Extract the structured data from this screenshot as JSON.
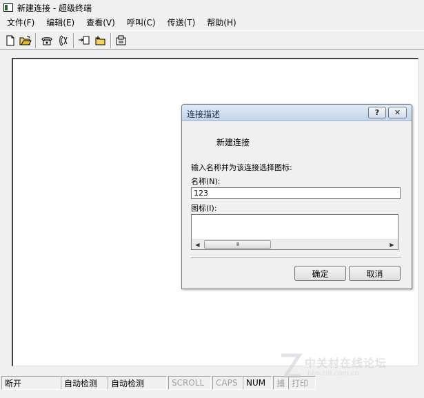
{
  "window": {
    "title": "新建连接 - 超级终端"
  },
  "menu": [
    {
      "label": "文件(F)"
    },
    {
      "label": "编辑(E)"
    },
    {
      "label": "查看(V)"
    },
    {
      "label": "呼叫(C)"
    },
    {
      "label": "传送(T)"
    },
    {
      "label": "帮助(H)"
    }
  ],
  "toolbar": {
    "buttons": [
      "new-icon",
      "open-icon",
      "call-icon",
      "disconnect-icon",
      "send-icon",
      "receive-icon",
      "properties-icon"
    ]
  },
  "dialog": {
    "title": "连接描述",
    "help_label": "?",
    "close_label": "✕",
    "connection_name": "新建连接",
    "prompt": "输入名称并为该连接选择图标:",
    "name_label": "名称(N):",
    "name_value": "123",
    "icon_label": "图标(I):",
    "scroll_thumb_label": "III",
    "ok_label": "确定",
    "cancel_label": "取消"
  },
  "status": {
    "connection": "断开",
    "detect1": "自动检测",
    "detect2": "自动检测",
    "scroll": "SCROLL",
    "caps": "CAPS",
    "num": "NUM",
    "capture": "捕",
    "print": "打印"
  },
  "watermark": {
    "text": "中关村在线论坛",
    "url": "bbs.zol.com.cn"
  }
}
